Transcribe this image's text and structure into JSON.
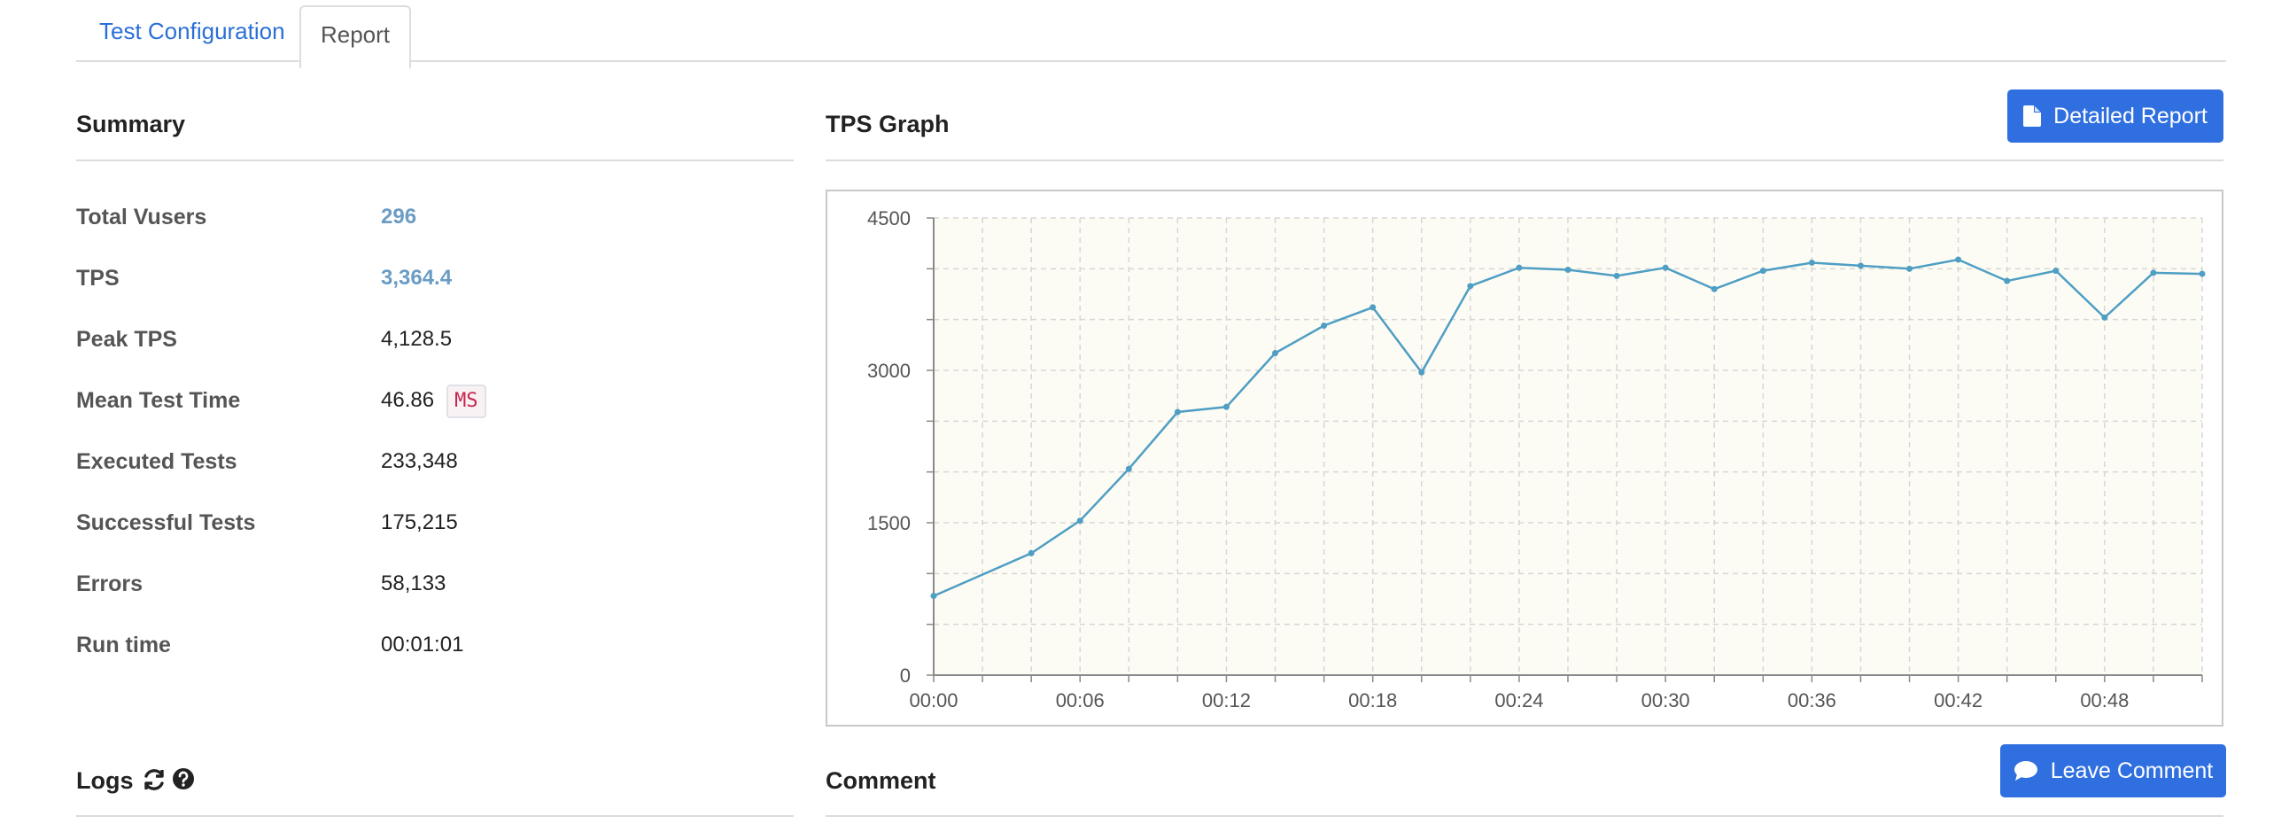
{
  "tabs": [
    {
      "label": "Test Configuration",
      "active": false
    },
    {
      "label": "Report",
      "active": true
    }
  ],
  "summary": {
    "title": "Summary",
    "rows": [
      {
        "label": "Total Vusers",
        "value": "296",
        "accent": true
      },
      {
        "label": "TPS",
        "value": "3,364.4",
        "accent": true
      },
      {
        "label": "Peak TPS",
        "value": "4,128.5",
        "accent": false
      },
      {
        "label": "Mean Test Time",
        "value": "46.86",
        "unit": "MS",
        "accent": false
      },
      {
        "label": "Executed Tests",
        "value": "233,348",
        "accent": false
      },
      {
        "label": "Successful Tests",
        "value": "175,215",
        "accent": false
      },
      {
        "label": "Errors",
        "value": "58,133",
        "accent": false
      },
      {
        "label": "Run time",
        "value": "00:01:01",
        "accent": false
      }
    ]
  },
  "tps_graph": {
    "title": "TPS Graph",
    "detailed_report_label": "Detailed Report"
  },
  "logs": {
    "title": "Logs"
  },
  "comment": {
    "title": "Comment",
    "leave_comment_label": "Leave Comment"
  },
  "colors": {
    "accent_blue": "#2f6fe0",
    "link_blue": "#2a6fd6",
    "value_accent": "#6b9cc4",
    "series_line": "#4f9ec4",
    "plot_background": "#fdfcf4"
  },
  "icons": {
    "detailed_report": "file-icon",
    "leave_comment": "comment-icon",
    "logs_refresh": "refresh-icon",
    "logs_help": "question-circle-icon"
  },
  "chart_data": {
    "type": "line",
    "x_unit": "seconds",
    "x": [
      0,
      4,
      6,
      8,
      10,
      12,
      14,
      16,
      18,
      20,
      22,
      24,
      26,
      28,
      30,
      32,
      34,
      36,
      38,
      40,
      42,
      44,
      46,
      48,
      50,
      52
    ],
    "series": [
      {
        "values": [
          780,
          1200,
          1520,
          2030,
          2590,
          2640,
          3170,
          3440,
          3620,
          2980,
          3830,
          4010,
          3990,
          3930,
          4010,
          3800,
          3980,
          4060,
          4030,
          4000,
          4090,
          3880,
          3980,
          3520,
          3960,
          3950
        ]
      }
    ],
    "x_tick_labels": [
      "00:00",
      "00:06",
      "00:12",
      "00:18",
      "00:24",
      "00:30",
      "00:36",
      "00:42",
      "00:48"
    ],
    "x_tick_values": [
      0,
      6,
      12,
      18,
      24,
      30,
      36,
      42,
      48
    ],
    "y_tick_labels": [
      "0",
      "1500",
      "3000",
      "4500"
    ],
    "y_tick_values": [
      0,
      1500,
      3000,
      4500
    ],
    "xlim": [
      0,
      52
    ],
    "ylim": [
      0,
      4500
    ],
    "grid": true,
    "title": "",
    "xlabel": "",
    "ylabel": ""
  }
}
